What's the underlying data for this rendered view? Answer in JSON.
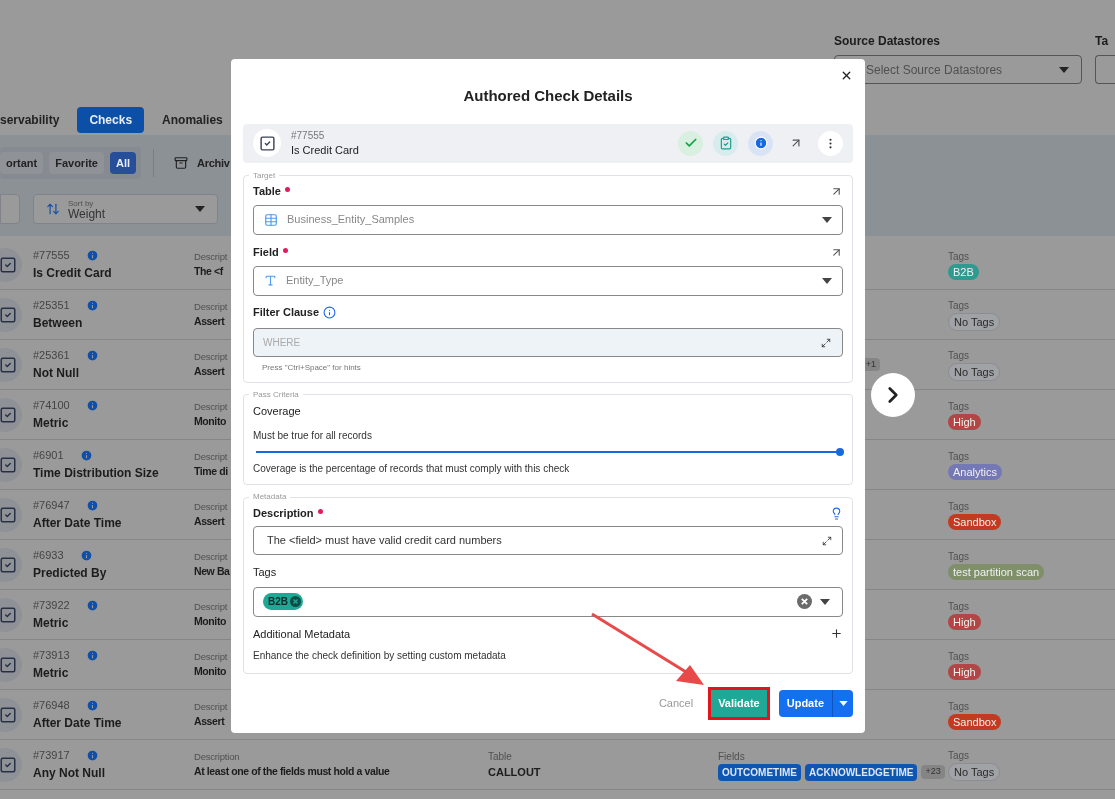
{
  "header": {
    "source_label": "Source Datastores",
    "source_placeholder": "Select Source Datastores",
    "next_label": "Ta"
  },
  "tabs": [
    {
      "label": "servability",
      "selected": false
    },
    {
      "label": "Checks",
      "selected": true
    },
    {
      "label": "Anomalies",
      "selected": false
    }
  ],
  "filters": [
    {
      "label": "ortant",
      "selected": false
    },
    {
      "label": "Favorite",
      "selected": false
    },
    {
      "label": "All",
      "selected": true
    }
  ],
  "archive": "Archiv",
  "sort": {
    "caption": "Sort by",
    "value": "Weight"
  },
  "rows": [
    {
      "id": "#77555",
      "name": "Is Credit Card",
      "description_label": "Descript",
      "description": "The <f",
      "tags_label": "Tags",
      "tags": [
        {
          "label": "B2B",
          "color": "#2f9a8f"
        }
      ]
    },
    {
      "id": "#25351",
      "name": "Between",
      "description_label": "Descript",
      "description": "Assert",
      "tags_label": "Tags",
      "tags": [],
      "no_tags": "No Tags"
    },
    {
      "id": "#25361",
      "name": "Not Null",
      "description_label": "Descript",
      "description": "Assert",
      "fields_more": "+1",
      "tags_label": "Tags",
      "tags": [],
      "no_tags": "No Tags"
    },
    {
      "id": "#74100",
      "name": "Metric",
      "description_label": "Descript",
      "description": "Monito",
      "tags_label": "Tags",
      "tags": [
        {
          "label": "High",
          "color": "#b24646"
        }
      ]
    },
    {
      "id": "#6901",
      "name": "Time Distribution Size",
      "description_label": "Descript",
      "description": "Time di",
      "tags_label": "Tags",
      "tags": [
        {
          "label": "Analytics",
          "color": "#7478b4"
        }
      ]
    },
    {
      "id": "#76947",
      "name": "After Date Time",
      "description_label": "Descript",
      "description": "Assert",
      "tags_label": "Tags",
      "tags": [
        {
          "label": "Sandbox",
          "color": "#c23b21"
        }
      ]
    },
    {
      "id": "#6933",
      "name": "Predicted By",
      "description_label": "Descript",
      "description": "New Ba",
      "tags_label": "Tags",
      "tags": [
        {
          "label": "test partition scan",
          "color": "#7f8f6a"
        }
      ]
    },
    {
      "id": "#73922",
      "name": "Metric",
      "description_label": "Descript",
      "description": "Monito",
      "tags_label": "Tags",
      "tags": [
        {
          "label": "High",
          "color": "#b24646"
        }
      ]
    },
    {
      "id": "#73913",
      "name": "Metric",
      "description_label": "Descript",
      "description": "Monito",
      "tags_label": "Tags",
      "tags": [
        {
          "label": "High",
          "color": "#b24646"
        }
      ]
    },
    {
      "id": "#76948",
      "name": "After Date Time",
      "description_label": "Descript",
      "description": "Assert",
      "tags_label": "Tags",
      "tags": [
        {
          "label": "Sandbox",
          "color": "#c23b21"
        }
      ]
    },
    {
      "id": "#73917",
      "name": "Any Not Null",
      "description_label": "Description",
      "description": "At least one of the fields must hold a value",
      "table_label": "Table",
      "table": "CALLOUT",
      "fields_label": "Fields",
      "fields": [
        "OUTCOMETIME",
        "ACKNOWLEDGETIME"
      ],
      "fields_more": "+23",
      "tags_label": "Tags",
      "tags": [],
      "no_tags": "No Tags"
    }
  ],
  "modal": {
    "title": "Authored Check Details",
    "check": {
      "id": "#77555",
      "name": "Is Credit Card"
    },
    "target": {
      "legend": "Target",
      "table_label": "Table",
      "table_required": true,
      "table_value": "Business_Entity_Samples",
      "field_label": "Field",
      "field_required": true,
      "field_value": "Entity_Type",
      "filter_label": "Filter Clause",
      "filter_placeholder": "WHERE",
      "filter_hint": "Press \"Ctrl+Space\" for hints"
    },
    "pass_criteria": {
      "legend": "Pass Criteria",
      "title": "Coverage",
      "subtitle": "Must be true for all records",
      "level": 1,
      "help": "Coverage is the percentage of records that must comply with this check"
    },
    "metadata": {
      "legend": "Metadata",
      "description_label": "Description",
      "description_required": true,
      "description_value": "The <field> must have valid credit card numbers",
      "tags_label": "Tags",
      "tags": [
        {
          "label": "B2B",
          "color": "#1fa896"
        }
      ],
      "additional_title": "Additional Metadata",
      "additional_help": "Enhance the check definition by setting custom metadata"
    },
    "actions": {
      "cancel": "Cancel",
      "validate": "Validate",
      "validate_highlighted": true,
      "update": "Update"
    }
  }
}
